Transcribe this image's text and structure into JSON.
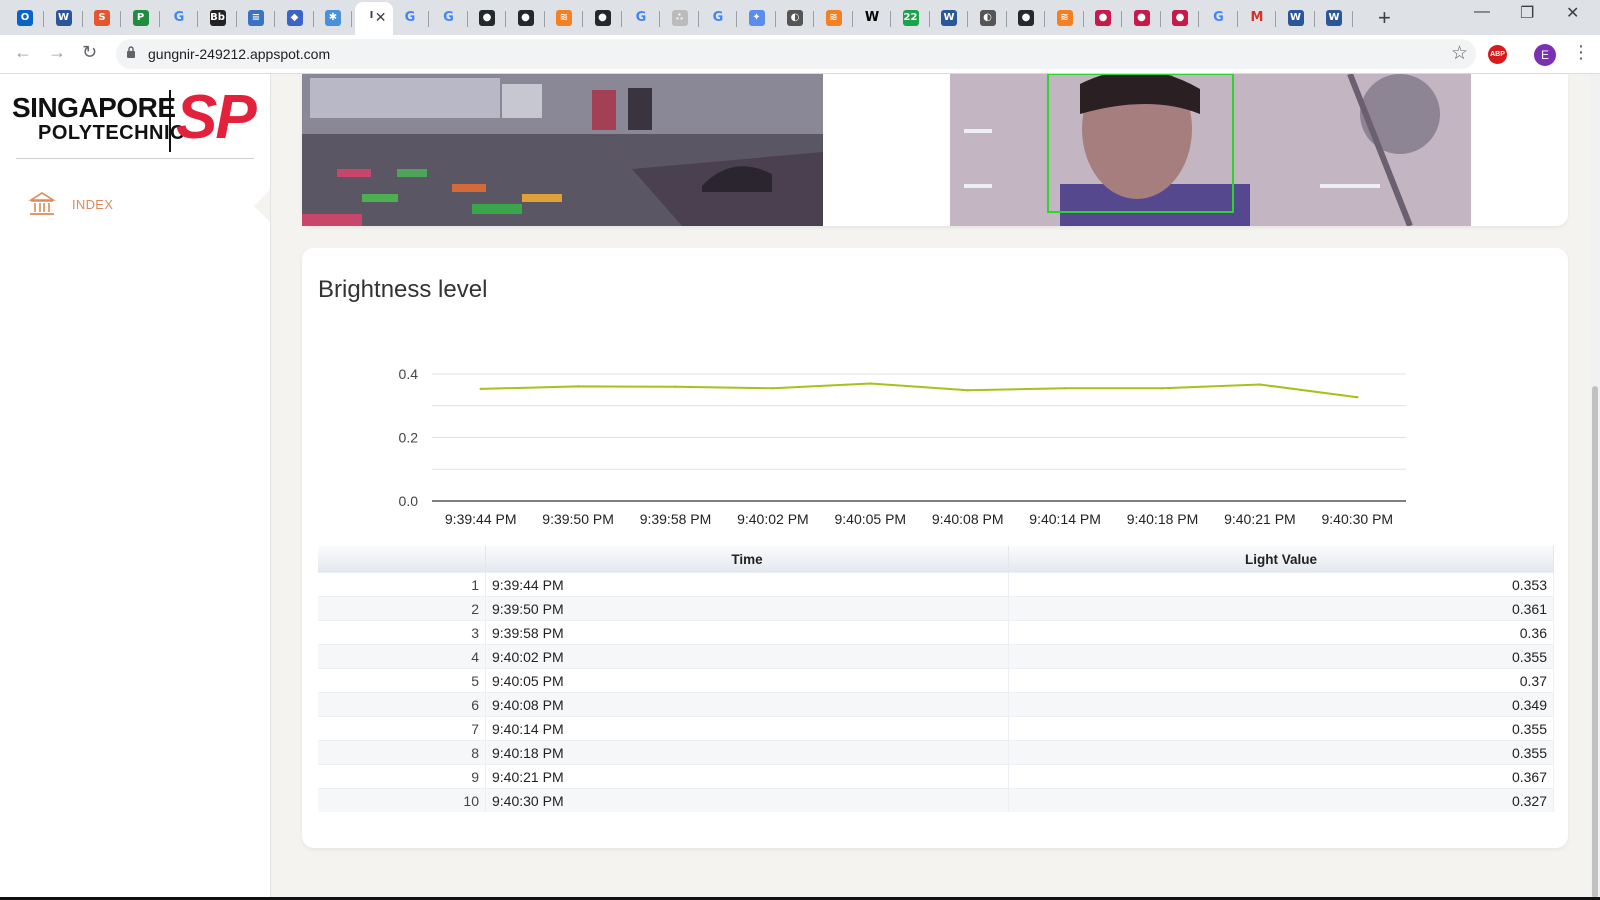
{
  "browser": {
    "url": "gungnir-249212.appspot.com",
    "avatar_letter": "E",
    "adblock_label": "ABP",
    "tabs": [
      {
        "icon": "outlook-icon",
        "color": "#0a64c8",
        "glyph": "O"
      },
      {
        "icon": "word-icon",
        "color": "#2b5797",
        "glyph": "W"
      },
      {
        "icon": "app-icon",
        "color": "#e4572e",
        "glyph": "S"
      },
      {
        "icon": "sheets-icon",
        "color": "#1e8e3e",
        "glyph": "P"
      },
      {
        "icon": "google-icon",
        "color": "#4285f4",
        "glyph": "G"
      },
      {
        "icon": "bb-icon",
        "color": "#222222",
        "glyph": "Bb"
      },
      {
        "icon": "stack-icon",
        "color": "#3b73c4",
        "glyph": "≡"
      },
      {
        "icon": "shield-icon",
        "color": "#3b63c8",
        "glyph": "◆"
      },
      {
        "icon": "snowflake-icon",
        "color": "#4a90d9",
        "glyph": "✱"
      },
      {
        "icon": "active-tab-icon",
        "color": "#ffffff",
        "glyph": "I"
      },
      {
        "icon": "google-icon",
        "color": "#4285f4",
        "glyph": "G"
      },
      {
        "icon": "google-icon",
        "color": "#4285f4",
        "glyph": "G"
      },
      {
        "icon": "github-icon",
        "color": "#24292e",
        "glyph": "●"
      },
      {
        "icon": "github-icon",
        "color": "#24292e",
        "glyph": "●"
      },
      {
        "icon": "stackoverflow-icon",
        "color": "#f48024",
        "glyph": "≋"
      },
      {
        "icon": "github-icon",
        "color": "#24292e",
        "glyph": "●"
      },
      {
        "icon": "google-icon",
        "color": "#4285f4",
        "glyph": "G"
      },
      {
        "icon": "loading-icon",
        "color": "#bbbbbb",
        "glyph": "∴"
      },
      {
        "icon": "google-icon",
        "color": "#4285f4",
        "glyph": "G"
      },
      {
        "icon": "settings-icon",
        "color": "#5b8def",
        "glyph": "✦"
      },
      {
        "icon": "globe-icon",
        "color": "#555555",
        "glyph": "◐"
      },
      {
        "icon": "stackoverflow-icon",
        "color": "#f48024",
        "glyph": "≋"
      },
      {
        "icon": "wikipedia-icon",
        "color": "#000000",
        "glyph": "W"
      },
      {
        "icon": "badge-icon",
        "color": "#1aa34a",
        "glyph": "22"
      },
      {
        "icon": "word-icon",
        "color": "#2b5797",
        "glyph": "W"
      },
      {
        "icon": "globe-icon",
        "color": "#555555",
        "glyph": "◐"
      },
      {
        "icon": "github-icon",
        "color": "#24292e",
        "glyph": "●"
      },
      {
        "icon": "stackoverflow-icon",
        "color": "#f48024",
        "glyph": "≋"
      },
      {
        "icon": "raspberry-icon",
        "color": "#c51a4a",
        "glyph": "●"
      },
      {
        "icon": "raspberry-icon",
        "color": "#c51a4a",
        "glyph": "●"
      },
      {
        "icon": "raspberry-icon",
        "color": "#c51a4a",
        "glyph": "●"
      },
      {
        "icon": "google-icon",
        "color": "#4285f4",
        "glyph": "G"
      },
      {
        "icon": "gmail-icon",
        "color": "#d93025",
        "glyph": "M"
      },
      {
        "icon": "word-icon",
        "color": "#2b5797",
        "glyph": "W"
      },
      {
        "icon": "word-icon",
        "color": "#2b5797",
        "glyph": "W"
      }
    ]
  },
  "sidebar": {
    "logo_line1": "SINGAPORE",
    "logo_line2": "POLYTECHNIC",
    "logo_mark": "SP",
    "brand_color": "#e4213b",
    "items": [
      {
        "label": "INDEX",
        "icon": "bank-icon",
        "color": "#e0885a"
      }
    ]
  },
  "main": {
    "chart_card": {
      "title": "Brightness level"
    },
    "table": {
      "headers": [
        "Time",
        "Light Value"
      ],
      "rows": [
        {
          "index": "1",
          "time": "9:39:44 PM",
          "value": "0.353"
        },
        {
          "index": "2",
          "time": "9:39:50 PM",
          "value": "0.361"
        },
        {
          "index": "3",
          "time": "9:39:58 PM",
          "value": "0.36"
        },
        {
          "index": "4",
          "time": "9:40:02 PM",
          "value": "0.355"
        },
        {
          "index": "5",
          "time": "9:40:05 PM",
          "value": "0.37"
        },
        {
          "index": "6",
          "time": "9:40:08 PM",
          "value": "0.349"
        },
        {
          "index": "7",
          "time": "9:40:14 PM",
          "value": "0.355"
        },
        {
          "index": "8",
          "time": "9:40:18 PM",
          "value": "0.355"
        },
        {
          "index": "9",
          "time": "9:40:21 PM",
          "value": "0.367"
        },
        {
          "index": "10",
          "time": "9:40:30 PM",
          "value": "0.327"
        }
      ]
    }
  },
  "chart_data": {
    "type": "line",
    "categories": [
      "9:39:44 PM",
      "9:39:50 PM",
      "9:39:58 PM",
      "9:40:02 PM",
      "9:40:05 PM",
      "9:40:08 PM",
      "9:40:14 PM",
      "9:40:18 PM",
      "9:40:21 PM",
      "9:40:30 PM"
    ],
    "series": [
      {
        "values": [
          0.353,
          0.361,
          0.36,
          0.355,
          0.37,
          0.349,
          0.355,
          0.355,
          0.367,
          0.327
        ],
        "color": "#a3c21a"
      }
    ],
    "yticks": [
      "0.0",
      "0.2",
      "0.4"
    ],
    "ylim": [
      0,
      0.4
    ],
    "grid": true,
    "legend": "none"
  }
}
